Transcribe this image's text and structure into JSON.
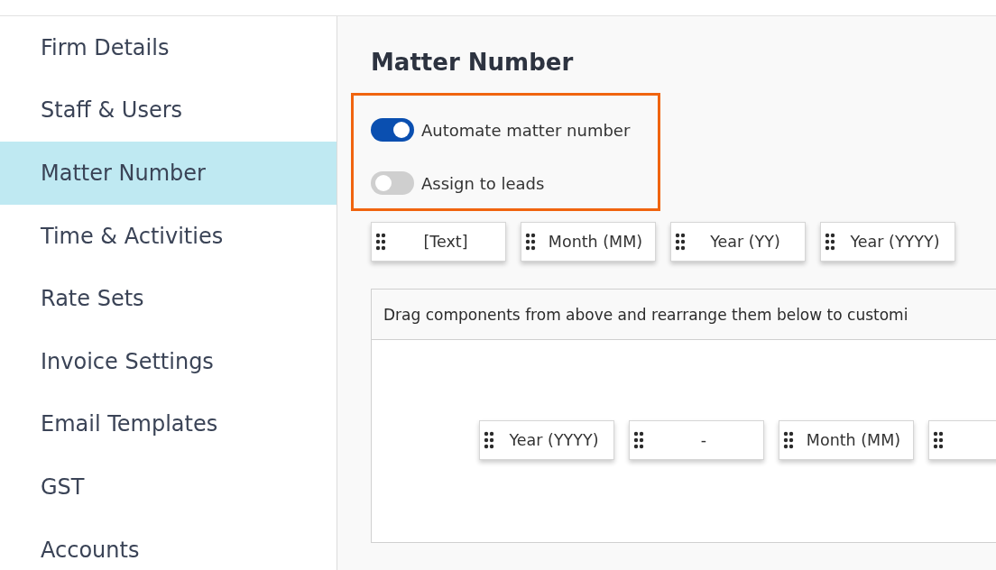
{
  "sidebar": {
    "items": [
      {
        "label": "Firm Details",
        "selected": false
      },
      {
        "label": "Staff & Users",
        "selected": false
      },
      {
        "label": "Matter Number",
        "selected": true
      },
      {
        "label": "Time & Activities",
        "selected": false
      },
      {
        "label": "Rate Sets",
        "selected": false
      },
      {
        "label": "Invoice Settings",
        "selected": false
      },
      {
        "label": "Email Templates",
        "selected": false
      },
      {
        "label": "GST",
        "selected": false
      },
      {
        "label": "Accounts",
        "selected": false
      }
    ]
  },
  "page_title": "Matter Number",
  "toggles": [
    {
      "label": "Automate matter number",
      "on": true
    },
    {
      "label": "Assign to leads",
      "on": false
    }
  ],
  "components": [
    {
      "label": "[Text]"
    },
    {
      "label": "Month (MM)"
    },
    {
      "label": "Year (YY)"
    },
    {
      "label": "Year (YYYY)"
    }
  ],
  "builder": {
    "instruction": "Drag components from above and rearrange them below to customi",
    "chips": [
      {
        "kind": "labeled",
        "label": "Year (YYYY)"
      },
      {
        "kind": "labeled",
        "label": "-"
      },
      {
        "kind": "labeled",
        "label": "Month (MM)"
      },
      {
        "kind": "blank"
      }
    ]
  }
}
